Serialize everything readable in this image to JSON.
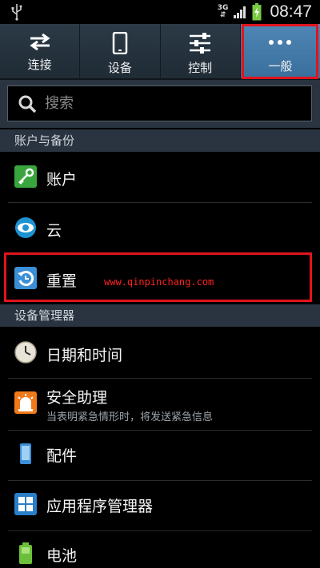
{
  "status_bar": {
    "net_type": "3G",
    "net_arrows": "⇵",
    "time": "08:47"
  },
  "tabs": [
    {
      "label": "连接",
      "icon": "swap-arrows-icon",
      "active": false
    },
    {
      "label": "设备",
      "icon": "phone-device-icon",
      "active": false
    },
    {
      "label": "控制",
      "icon": "sliders-icon",
      "active": false
    },
    {
      "label": "一般",
      "icon": "more-dots-icon",
      "active": true
    }
  ],
  "search": {
    "placeholder": "搜索"
  },
  "sections": {
    "accounts": "账户与备份",
    "device_manager": "设备管理器"
  },
  "items": {
    "account": "账户",
    "cloud": "云",
    "reset": "重置",
    "date_time": "日期和时间",
    "safety": "安全助理",
    "safety_sub": "当表明紧急情形时，将发送紧急信息",
    "accessories": "配件",
    "app_manager": "应用程序管理器",
    "battery": "电池"
  },
  "watermark": "www.qinpinchang.com",
  "colors": {
    "highlight": "#e0141e",
    "active_tab": "#4a82b0",
    "section_bg": "#2a3440"
  }
}
